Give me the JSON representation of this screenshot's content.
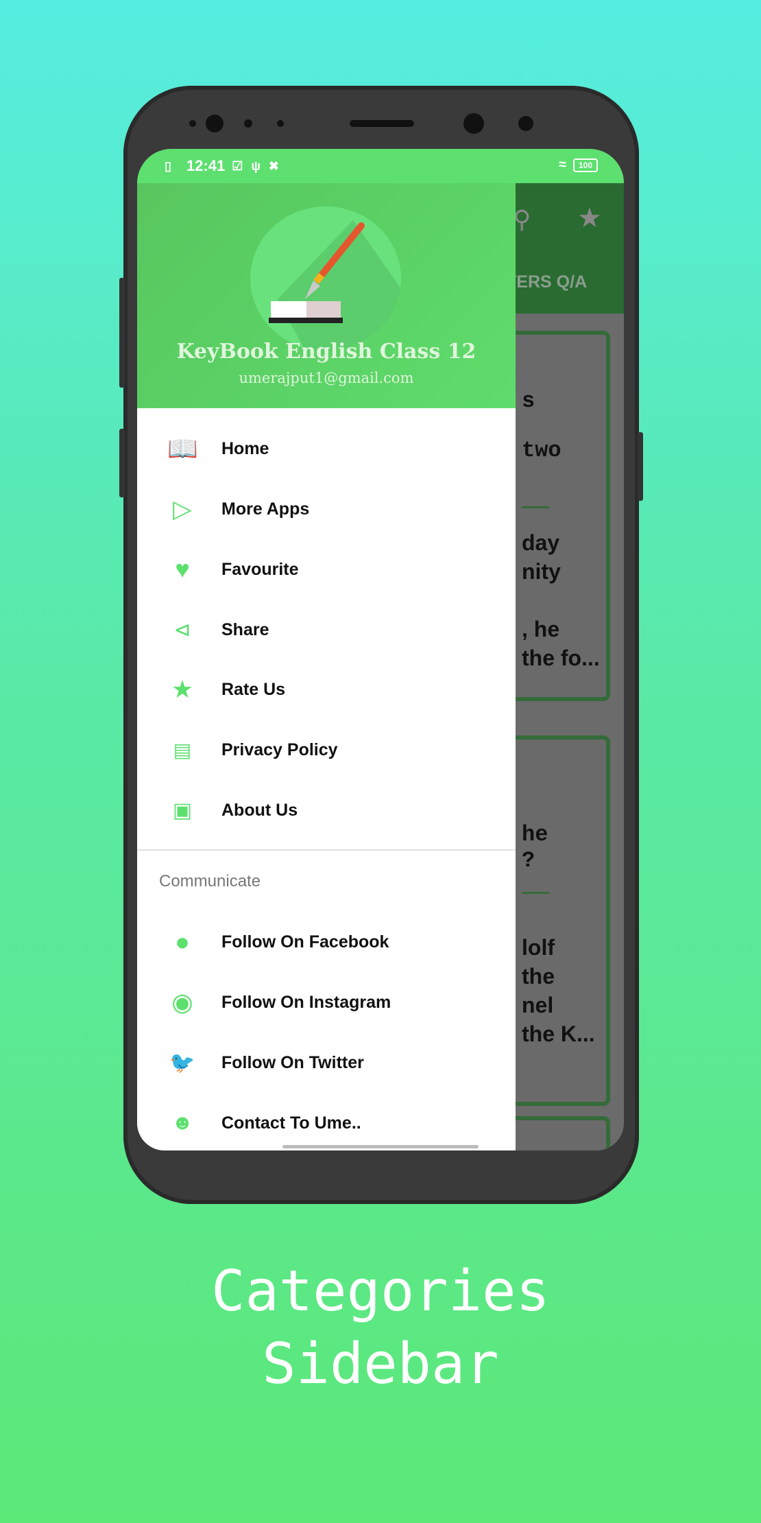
{
  "status_bar": {
    "time": "12:41",
    "battery": "100"
  },
  "app_bar": {
    "tab_label": "CTERS Q/A",
    "icons": [
      "search-icon",
      "star-icon"
    ]
  },
  "background_cards": [
    {
      "title_lines": [
        "s",
        "two"
      ],
      "body": "day\nnity\n\n, he\nthe fo..."
    },
    {
      "title_lines": [
        "he",
        "?"
      ],
      "body": "lolf\nthe\nnel\nthe K..."
    }
  ],
  "drawer": {
    "title": "KeyBook English Class 12",
    "email": "umerajput1@gmail.com",
    "items": [
      {
        "label": "Home",
        "icon": "book-open-icon"
      },
      {
        "label": "More Apps",
        "icon": "play-store-icon"
      },
      {
        "label": "Favourite",
        "icon": "heart-icon"
      },
      {
        "label": "Share",
        "icon": "share-icon"
      },
      {
        "label": "Rate Us",
        "icon": "star-icon"
      },
      {
        "label": "Privacy Policy",
        "icon": "barrier-icon"
      },
      {
        "label": "About Us",
        "icon": "badge-icon"
      }
    ],
    "section_label": "Communicate",
    "communicate": [
      {
        "label": "Follow On Facebook",
        "icon": "facebook-icon"
      },
      {
        "label": "Follow On Instagram",
        "icon": "instagram-icon"
      },
      {
        "label": "Follow On Twitter",
        "icon": "twitter-icon"
      },
      {
        "label": "Contact To Ume..",
        "icon": "people-icon"
      }
    ]
  },
  "caption": {
    "line1": "Categories",
    "line2": "Sidebar"
  },
  "colors": {
    "accent": "#5ce06e",
    "header": "#5fdc6c"
  }
}
